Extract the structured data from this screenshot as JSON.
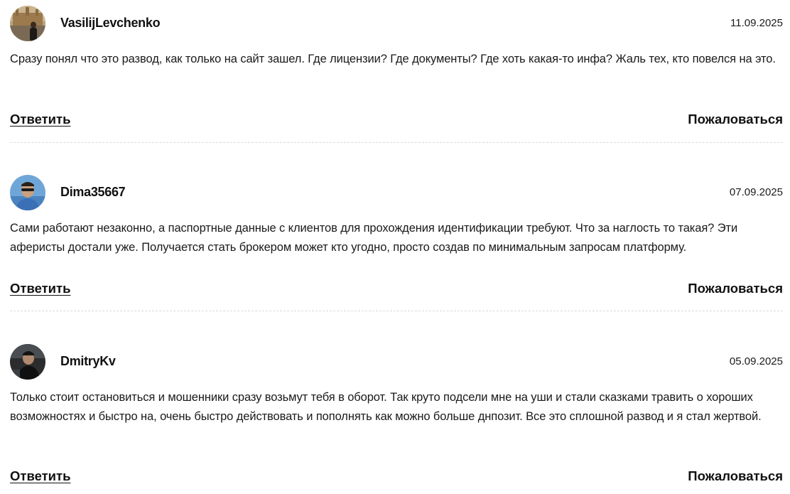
{
  "comments": [
    {
      "author": "VasilijLevchenko",
      "date": "11.09.2025",
      "avatar_icon": "user-photo-landmark",
      "text": "Сразу понял что это развод, как только на сайт зашел. Где лицензии? Где документы? Где хоть какая-то инфа? Жаль тех, кто повелся на это.",
      "reply_label": "Ответить",
      "report_label": "Пожаловаться"
    },
    {
      "author": "Dima35667",
      "date": "07.09.2025",
      "avatar_icon": "user-photo-sunglasses",
      "text": "Сами работают незаконно, а паспортные данные с клиентов для прохождения идентификации требуют. Что за наглость то такая? Эти аферисты достали уже. Получается стать брокером может кто угодно, просто создав по минимальным запросам платформу.",
      "reply_label": "Ответить",
      "report_label": "Пожаловаться"
    },
    {
      "author": "DmitryKv",
      "date": "05.09.2025",
      "avatar_icon": "user-photo-car",
      "text": "Только стоит остановиться и мошенники сразу возьмут тебя в оборот. Так круто подсели мне на уши и стали сказками травить о хороших возможностях и быстро на, очень быстро действовать и пополнять как можно больше днпозит. Все это сплошной развод и я стал жертвой.",
      "reply_label": "Ответить",
      "report_label": "Пожаловаться"
    }
  ],
  "colors": {
    "text": "#1a1a1a",
    "divider": "#d9d9d9",
    "background": "#ffffff"
  }
}
